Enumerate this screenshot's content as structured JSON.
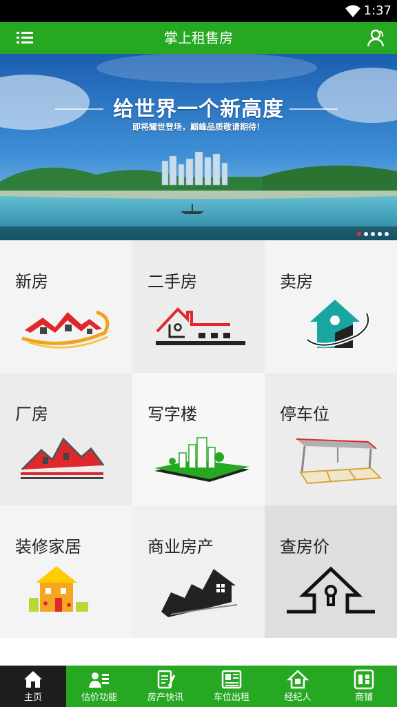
{
  "status_bar": {
    "time": "1:37"
  },
  "app_bar": {
    "title": "掌上租售房"
  },
  "banner": {
    "headline": "给世界一个新高度",
    "subline": "即将耀世登场，巅峰品质敬请期待！",
    "slide_count": 5,
    "active_slide": 1
  },
  "categories": [
    {
      "label": "新房",
      "icon": "new-house-icon",
      "bg": "#f4f4f4"
    },
    {
      "label": "二手房",
      "icon": "second-hand-house-icon",
      "bg": "#ececec"
    },
    {
      "label": "卖房",
      "icon": "sell-house-icon",
      "bg": "#f4f4f4"
    },
    {
      "label": "厂房",
      "icon": "factory-icon",
      "bg": "#ececec"
    },
    {
      "label": "写字楼",
      "icon": "office-building-icon",
      "bg": "#f7f7f7"
    },
    {
      "label": "停车位",
      "icon": "parking-space-icon",
      "bg": "#ececec"
    },
    {
      "label": "装修家居",
      "icon": "decoration-home-icon",
      "bg": "#f4f4f4"
    },
    {
      "label": "商业房产",
      "icon": "commercial-property-icon",
      "bg": "#f0f0f0"
    },
    {
      "label": "查房价",
      "icon": "house-price-icon",
      "bg": "#dedede"
    }
  ],
  "tabs": [
    {
      "label": "主页",
      "icon": "home-icon",
      "active": true
    },
    {
      "label": "估价功能",
      "icon": "valuation-icon",
      "active": false
    },
    {
      "label": "房产快讯",
      "icon": "news-icon",
      "active": false
    },
    {
      "label": "车位出租",
      "icon": "parking-rent-icon",
      "active": false
    },
    {
      "label": "经纪人",
      "icon": "agent-icon",
      "active": false
    },
    {
      "label": "商铺",
      "icon": "shop-icon",
      "active": false
    }
  ],
  "colors": {
    "primary": "#27a823",
    "active_tab": "#1d1d1d",
    "roof_red": "#e0282c",
    "accent_teal": "#1aa6a0"
  }
}
